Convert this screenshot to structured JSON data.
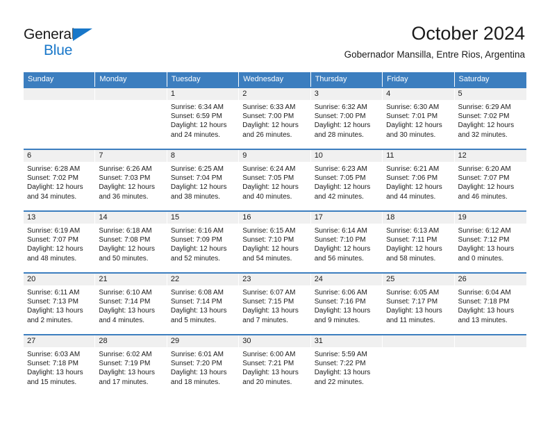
{
  "brand": {
    "name_part1": "General",
    "name_part2": "Blue",
    "triangle_color": "#1877c9"
  },
  "header": {
    "title": "October 2024",
    "subtitle": "Gobernador Mansilla, Entre Rios, Argentina"
  },
  "theme": {
    "header_blue": "#3c7ebf",
    "date_band_gray": "#f0f0f0",
    "text_color": "#1a1a1a"
  },
  "weekdays": [
    "Sunday",
    "Monday",
    "Tuesday",
    "Wednesday",
    "Thursday",
    "Friday",
    "Saturday"
  ],
  "weeks": [
    [
      {
        "day": "",
        "sunrise": "",
        "sunset": "",
        "daylight1": "",
        "daylight2": ""
      },
      {
        "day": "",
        "sunrise": "",
        "sunset": "",
        "daylight1": "",
        "daylight2": ""
      },
      {
        "day": "1",
        "sunrise": "Sunrise: 6:34 AM",
        "sunset": "Sunset: 6:59 PM",
        "daylight1": "Daylight: 12 hours",
        "daylight2": "and 24 minutes."
      },
      {
        "day": "2",
        "sunrise": "Sunrise: 6:33 AM",
        "sunset": "Sunset: 7:00 PM",
        "daylight1": "Daylight: 12 hours",
        "daylight2": "and 26 minutes."
      },
      {
        "day": "3",
        "sunrise": "Sunrise: 6:32 AM",
        "sunset": "Sunset: 7:00 PM",
        "daylight1": "Daylight: 12 hours",
        "daylight2": "and 28 minutes."
      },
      {
        "day": "4",
        "sunrise": "Sunrise: 6:30 AM",
        "sunset": "Sunset: 7:01 PM",
        "daylight1": "Daylight: 12 hours",
        "daylight2": "and 30 minutes."
      },
      {
        "day": "5",
        "sunrise": "Sunrise: 6:29 AM",
        "sunset": "Sunset: 7:02 PM",
        "daylight1": "Daylight: 12 hours",
        "daylight2": "and 32 minutes."
      }
    ],
    [
      {
        "day": "6",
        "sunrise": "Sunrise: 6:28 AM",
        "sunset": "Sunset: 7:02 PM",
        "daylight1": "Daylight: 12 hours",
        "daylight2": "and 34 minutes."
      },
      {
        "day": "7",
        "sunrise": "Sunrise: 6:26 AM",
        "sunset": "Sunset: 7:03 PM",
        "daylight1": "Daylight: 12 hours",
        "daylight2": "and 36 minutes."
      },
      {
        "day": "8",
        "sunrise": "Sunrise: 6:25 AM",
        "sunset": "Sunset: 7:04 PM",
        "daylight1": "Daylight: 12 hours",
        "daylight2": "and 38 minutes."
      },
      {
        "day": "9",
        "sunrise": "Sunrise: 6:24 AM",
        "sunset": "Sunset: 7:05 PM",
        "daylight1": "Daylight: 12 hours",
        "daylight2": "and 40 minutes."
      },
      {
        "day": "10",
        "sunrise": "Sunrise: 6:23 AM",
        "sunset": "Sunset: 7:05 PM",
        "daylight1": "Daylight: 12 hours",
        "daylight2": "and 42 minutes."
      },
      {
        "day": "11",
        "sunrise": "Sunrise: 6:21 AM",
        "sunset": "Sunset: 7:06 PM",
        "daylight1": "Daylight: 12 hours",
        "daylight2": "and 44 minutes."
      },
      {
        "day": "12",
        "sunrise": "Sunrise: 6:20 AM",
        "sunset": "Sunset: 7:07 PM",
        "daylight1": "Daylight: 12 hours",
        "daylight2": "and 46 minutes."
      }
    ],
    [
      {
        "day": "13",
        "sunrise": "Sunrise: 6:19 AM",
        "sunset": "Sunset: 7:07 PM",
        "daylight1": "Daylight: 12 hours",
        "daylight2": "and 48 minutes."
      },
      {
        "day": "14",
        "sunrise": "Sunrise: 6:18 AM",
        "sunset": "Sunset: 7:08 PM",
        "daylight1": "Daylight: 12 hours",
        "daylight2": "and 50 minutes."
      },
      {
        "day": "15",
        "sunrise": "Sunrise: 6:16 AM",
        "sunset": "Sunset: 7:09 PM",
        "daylight1": "Daylight: 12 hours",
        "daylight2": "and 52 minutes."
      },
      {
        "day": "16",
        "sunrise": "Sunrise: 6:15 AM",
        "sunset": "Sunset: 7:10 PM",
        "daylight1": "Daylight: 12 hours",
        "daylight2": "and 54 minutes."
      },
      {
        "day": "17",
        "sunrise": "Sunrise: 6:14 AM",
        "sunset": "Sunset: 7:10 PM",
        "daylight1": "Daylight: 12 hours",
        "daylight2": "and 56 minutes."
      },
      {
        "day": "18",
        "sunrise": "Sunrise: 6:13 AM",
        "sunset": "Sunset: 7:11 PM",
        "daylight1": "Daylight: 12 hours",
        "daylight2": "and 58 minutes."
      },
      {
        "day": "19",
        "sunrise": "Sunrise: 6:12 AM",
        "sunset": "Sunset: 7:12 PM",
        "daylight1": "Daylight: 13 hours",
        "daylight2": "and 0 minutes."
      }
    ],
    [
      {
        "day": "20",
        "sunrise": "Sunrise: 6:11 AM",
        "sunset": "Sunset: 7:13 PM",
        "daylight1": "Daylight: 13 hours",
        "daylight2": "and 2 minutes."
      },
      {
        "day": "21",
        "sunrise": "Sunrise: 6:10 AM",
        "sunset": "Sunset: 7:14 PM",
        "daylight1": "Daylight: 13 hours",
        "daylight2": "and 4 minutes."
      },
      {
        "day": "22",
        "sunrise": "Sunrise: 6:08 AM",
        "sunset": "Sunset: 7:14 PM",
        "daylight1": "Daylight: 13 hours",
        "daylight2": "and 5 minutes."
      },
      {
        "day": "23",
        "sunrise": "Sunrise: 6:07 AM",
        "sunset": "Sunset: 7:15 PM",
        "daylight1": "Daylight: 13 hours",
        "daylight2": "and 7 minutes."
      },
      {
        "day": "24",
        "sunrise": "Sunrise: 6:06 AM",
        "sunset": "Sunset: 7:16 PM",
        "daylight1": "Daylight: 13 hours",
        "daylight2": "and 9 minutes."
      },
      {
        "day": "25",
        "sunrise": "Sunrise: 6:05 AM",
        "sunset": "Sunset: 7:17 PM",
        "daylight1": "Daylight: 13 hours",
        "daylight2": "and 11 minutes."
      },
      {
        "day": "26",
        "sunrise": "Sunrise: 6:04 AM",
        "sunset": "Sunset: 7:18 PM",
        "daylight1": "Daylight: 13 hours",
        "daylight2": "and 13 minutes."
      }
    ],
    [
      {
        "day": "27",
        "sunrise": "Sunrise: 6:03 AM",
        "sunset": "Sunset: 7:18 PM",
        "daylight1": "Daylight: 13 hours",
        "daylight2": "and 15 minutes."
      },
      {
        "day": "28",
        "sunrise": "Sunrise: 6:02 AM",
        "sunset": "Sunset: 7:19 PM",
        "daylight1": "Daylight: 13 hours",
        "daylight2": "and 17 minutes."
      },
      {
        "day": "29",
        "sunrise": "Sunrise: 6:01 AM",
        "sunset": "Sunset: 7:20 PM",
        "daylight1": "Daylight: 13 hours",
        "daylight2": "and 18 minutes."
      },
      {
        "day": "30",
        "sunrise": "Sunrise: 6:00 AM",
        "sunset": "Sunset: 7:21 PM",
        "daylight1": "Daylight: 13 hours",
        "daylight2": "and 20 minutes."
      },
      {
        "day": "31",
        "sunrise": "Sunrise: 5:59 AM",
        "sunset": "Sunset: 7:22 PM",
        "daylight1": "Daylight: 13 hours",
        "daylight2": "and 22 minutes."
      },
      {
        "day": "",
        "sunrise": "",
        "sunset": "",
        "daylight1": "",
        "daylight2": ""
      },
      {
        "day": "",
        "sunrise": "",
        "sunset": "",
        "daylight1": "",
        "daylight2": ""
      }
    ]
  ]
}
